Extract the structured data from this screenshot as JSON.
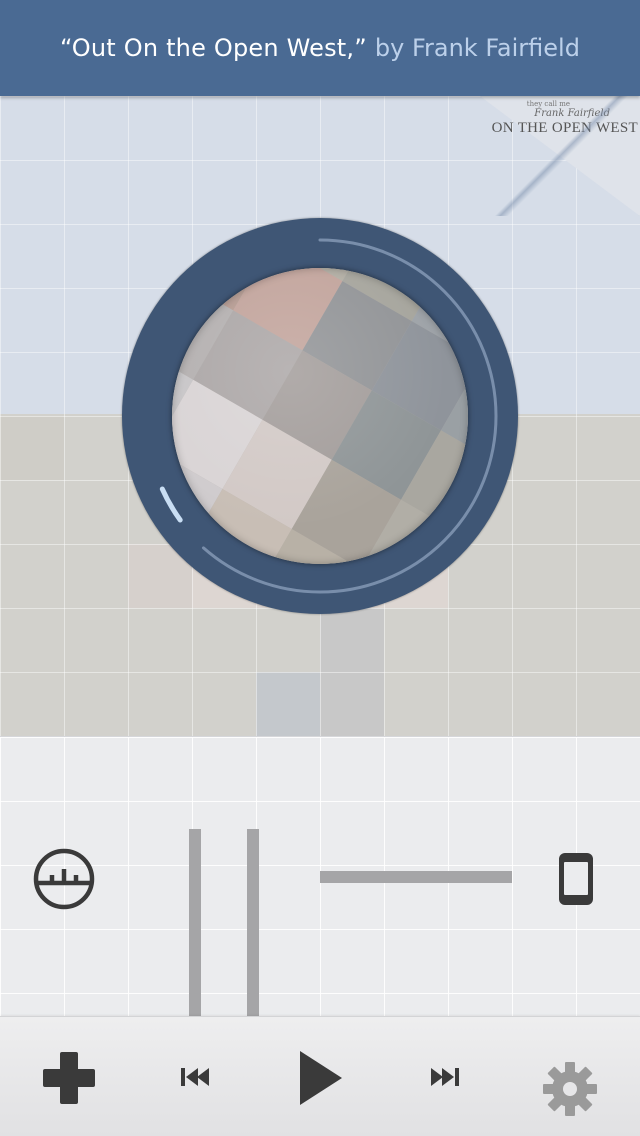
{
  "header": {
    "track_title": "“Out On the Open West,”",
    "artist_text": "by Frank Fairfield"
  },
  "album_thumb": {
    "pre_text": "they call me",
    "artist_text": "Frank Fairfield",
    "title_text": "ON THE OPEN WEST"
  },
  "playback": {
    "progress": 0.03
  },
  "icons": {
    "equalizer": "equalizer-icon",
    "output_device": "phone-icon",
    "add": "plus-icon",
    "previous": "skip-back-icon",
    "play": "play-icon",
    "next": "skip-forward-icon",
    "settings": "gear-icon"
  },
  "colors": {
    "header_bg": "#4a6a93",
    "header_text": "#ffffff",
    "header_artist": "#bcd0ea",
    "dial_ring": "#3f5675",
    "toolbar_icon": "#3a3a3a",
    "settings_icon": "#9a9a9a"
  }
}
